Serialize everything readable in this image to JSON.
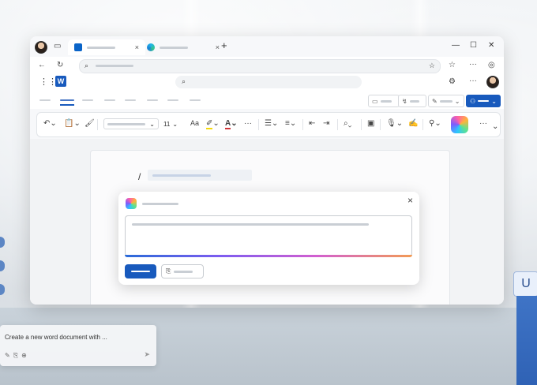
{
  "browser": {
    "tabs": [
      {
        "icon": "outlook-icon",
        "label": ""
      },
      {
        "icon": "edge-icon",
        "label": ""
      }
    ],
    "new_tab": "+",
    "close": "×"
  },
  "word": {
    "logo": "W"
  },
  "toolbar": {
    "font_size": "11",
    "aa_label": "Aa"
  },
  "document": {
    "slash": "/"
  },
  "copilot_dialog": {
    "close": "×"
  },
  "prompt_card": {
    "text": "Create a new word document with ..."
  },
  "keycap": {
    "glyph": "U"
  },
  "colors": {
    "accent": "#185abd",
    "highlight": "#f5d90a",
    "font_color": "#d13438"
  }
}
